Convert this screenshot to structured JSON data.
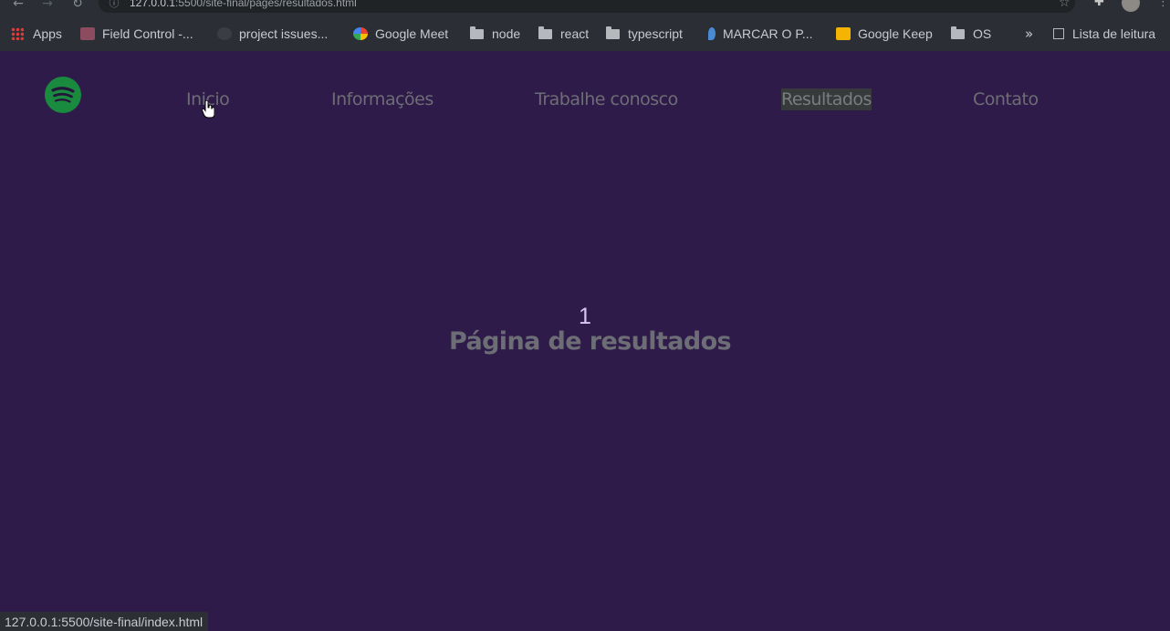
{
  "browser": {
    "url_host": "127.0.0.1",
    "url_path": ":5500/site-final/pages/resultados.html",
    "bookmarks": [
      {
        "label": "Apps",
        "icon": "apps-grid-icon"
      },
      {
        "label": "Field Control -...",
        "icon": "field-control-icon"
      },
      {
        "label": "project issues...",
        "icon": "github-icon"
      },
      {
        "label": "Google Meet",
        "icon": "google-meet-icon"
      },
      {
        "label": "node",
        "icon": "folder-icon"
      },
      {
        "label": "react",
        "icon": "folder-icon"
      },
      {
        "label": "typescript",
        "icon": "folder-icon"
      },
      {
        "label": "MARCAR O P...",
        "icon": "marker-icon"
      },
      {
        "label": "Google Keep",
        "icon": "google-keep-icon"
      },
      {
        "label": "OS",
        "icon": "folder-icon"
      }
    ],
    "more_label": "»",
    "reading_list_label": "Lista de leitura",
    "status_url": "127.0.0.1:5500/site-final/index.html"
  },
  "site": {
    "nav": [
      {
        "label": "Inicio",
        "active": false
      },
      {
        "label": "Informações",
        "active": false
      },
      {
        "label": "Trabalhe conosco",
        "active": false
      },
      {
        "label": "Resultados",
        "active": true
      },
      {
        "label": "Contato",
        "active": false
      }
    ],
    "logo_icon": "spotify-logo-icon",
    "colors": {
      "background": "#2f1b4a",
      "logo": "#1a8a3e",
      "nav_text": "#6d6d75",
      "page_number": "#d9c6f0"
    }
  },
  "main": {
    "page_number": "1",
    "title": "Página de resultados"
  }
}
